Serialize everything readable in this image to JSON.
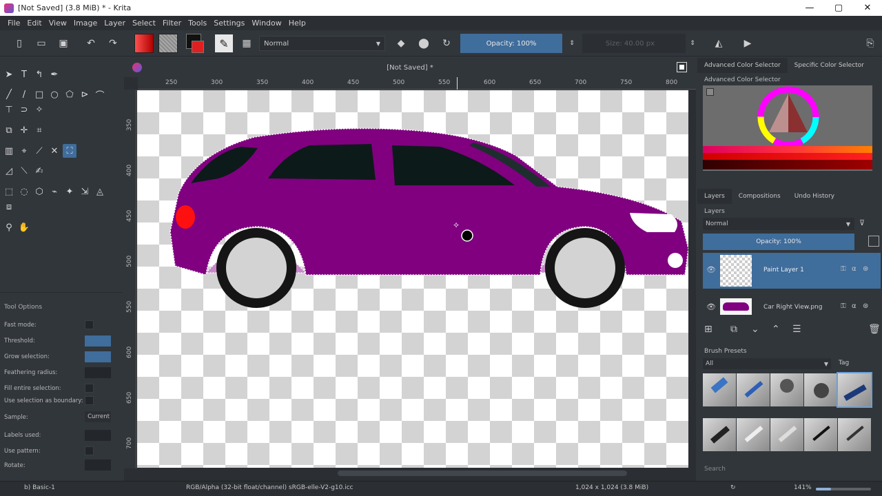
{
  "window": {
    "title": "[Not Saved]  (3.8 MiB)  * - Krita",
    "minimize": "—",
    "maximize": "▢",
    "close": "✕"
  },
  "menu": [
    "File",
    "Edit",
    "View",
    "Image",
    "Layer",
    "Select",
    "Filter",
    "Tools",
    "Settings",
    "Window",
    "Help"
  ],
  "toolbar": {
    "blend_mode": "Normal",
    "opacity_label": "Opacity: 100%",
    "size_label": "Size: 40.00 px",
    "fg_color": "#e02020",
    "bg_color": "#9a9a9a",
    "accent": "#3f6d9c"
  },
  "document": {
    "tab_title": "[Not Saved]  *",
    "car_body_color": "#800080",
    "window_color": "#0d1a1a"
  },
  "rulers": {
    "top": [
      "250",
      "300",
      "350",
      "400",
      "450",
      "500",
      "550",
      "600",
      "650",
      "700",
      "750",
      "800"
    ],
    "left": [
      "350",
      "400",
      "450",
      "500",
      "550",
      "600",
      "650",
      "700"
    ]
  },
  "tool_options": {
    "header": "Tool Options",
    "fast_mode": "Fast mode:",
    "threshold": "Threshold:",
    "grow_selection": "Grow selection:",
    "feathering_radius": "Feathering radius:",
    "fill_entire_selection": "Fill entire selection:",
    "use_selection_as_boundary": "Use selection as boundary:",
    "sample": "Sample:",
    "sample_value": "Current",
    "labels_used": "Labels used:",
    "use_pattern": "Use pattern:",
    "rotate": "Rotate:"
  },
  "right_panel": {
    "tab_advanced": "Advanced Color Selector",
    "tab_specific": "Specific Color Selector",
    "advanced_title": "Advanced Color Selector",
    "layers_tab": "Layers",
    "compositions_tab": "Compositions",
    "undo_tab": "Undo History",
    "layers_title": "Layers",
    "layer_blend": "Normal",
    "layer_opacity": "Opacity:  100%",
    "layers": [
      "Paint Layer 1",
      "Car Right View.png"
    ],
    "brush_presets_title": "Brush Presets",
    "brush_filter": "All",
    "brush_tag": "Tag",
    "search_placeholder": "Search"
  },
  "status": {
    "brush": "b) Basic-1",
    "color_space": "RGB/Alpha (32-bit float/channel)  sRGB-elle-V2-g10.icc",
    "doc_size": "1,024 x 1,024 (3.8 MiB)",
    "zoom": "141%"
  }
}
